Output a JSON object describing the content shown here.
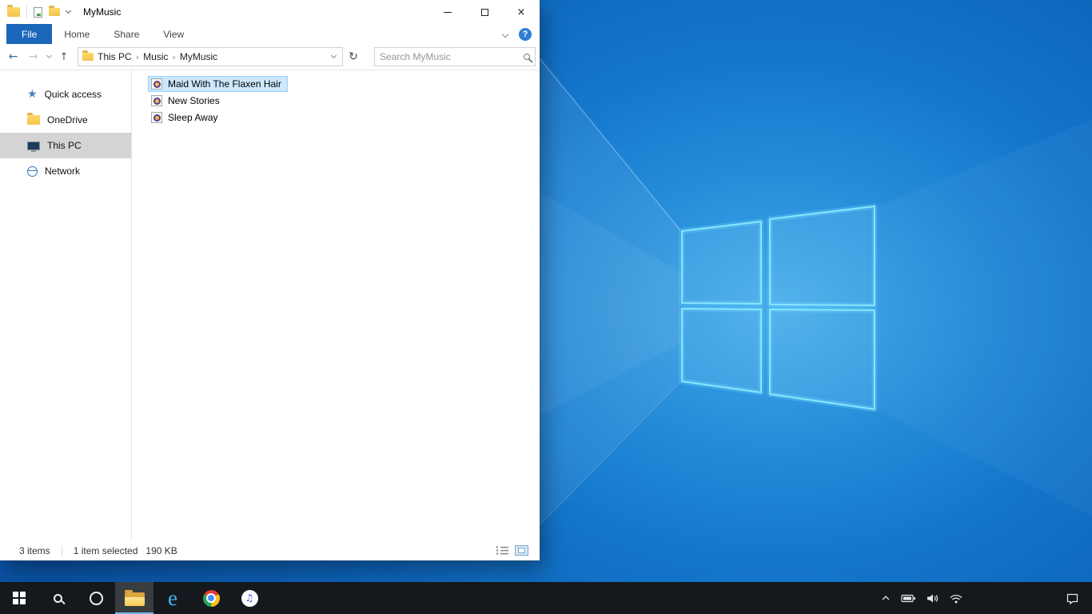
{
  "colors": {
    "accent_blue": "#1a66b8",
    "selection_bg": "#cce8ff",
    "selection_border": "#99d1ff",
    "taskbar_bg": "#15181c"
  },
  "explorer": {
    "title": "MyMusic",
    "ribbon_tabs": [
      {
        "label": "File",
        "active": true
      },
      {
        "label": "Home",
        "active": false
      },
      {
        "label": "Share",
        "active": false
      },
      {
        "label": "View",
        "active": false
      }
    ],
    "help_label": "?",
    "navigation": {
      "breadcrumb": [
        {
          "label": "This PC"
        },
        {
          "label": "Music"
        },
        {
          "label": "MyMusic"
        }
      ],
      "search_placeholder": "Search MyMusic"
    },
    "sidebar_items": [
      {
        "label": "Quick access",
        "icon": "star-icon",
        "selected": false
      },
      {
        "label": "OneDrive",
        "icon": "folder-icon",
        "selected": false
      },
      {
        "label": "This PC",
        "icon": "computer-icon",
        "selected": true
      },
      {
        "label": "Network",
        "icon": "network-icon",
        "selected": false
      }
    ],
    "files": [
      {
        "name": "Maid With The Flaxen Hair",
        "icon": "media-file-icon",
        "selected": true
      },
      {
        "name": "New Stories",
        "icon": "media-file-icon",
        "selected": false
      },
      {
        "name": "Sleep Away",
        "icon": "media-file-icon",
        "selected": false
      }
    ],
    "status_bar": {
      "item_count": "3 items",
      "selection_summary": "1 item selected",
      "selection_size": "190 KB",
      "view_toggle_icons": [
        "details-view-icon",
        "large-icons-view-icon"
      ]
    }
  },
  "taskbar": {
    "buttons": [
      {
        "name": "start",
        "icon": "windows-logo-icon"
      },
      {
        "name": "search",
        "icon": "search-icon"
      },
      {
        "name": "cortana",
        "icon": "cortana-ring-icon"
      },
      {
        "name": "file-explorer",
        "icon": "folder-icon",
        "active": true
      },
      {
        "name": "internet-explorer",
        "icon": "ie-icon"
      },
      {
        "name": "chrome",
        "icon": "chrome-icon"
      },
      {
        "name": "itunes",
        "icon": "itunes-icon"
      }
    ],
    "ie_glyph": "e",
    "itunes_glyph": "♫",
    "tray_icons": [
      "chevron-up-icon",
      "battery-icon",
      "volume-icon",
      "wifi-icon"
    ],
    "action_center_icon": "action-center-icon"
  }
}
